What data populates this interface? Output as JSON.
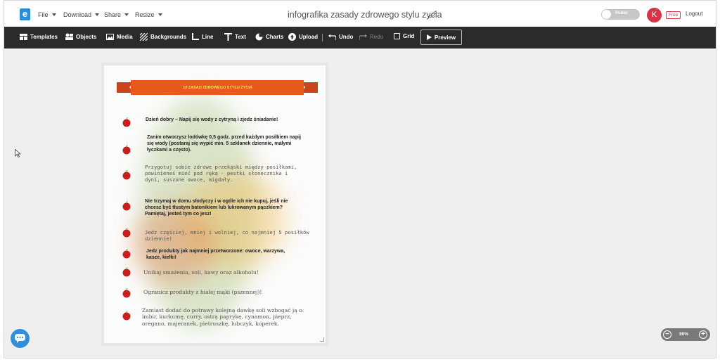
{
  "app": {
    "logo_letter": "e"
  },
  "menu": {
    "file": "File",
    "download": "Download",
    "share": "Share",
    "resize": "Resize"
  },
  "document": {
    "title": "infografika zasady zdrowego stylu zycia"
  },
  "visibility": {
    "label": "Public"
  },
  "account": {
    "avatar_letter": "K",
    "plan": "Free",
    "logout": "Logout"
  },
  "toolbar": {
    "templates": "Templates",
    "objects": "Objects",
    "media": "Media",
    "backgrounds": "Backgrounds",
    "line": "Line",
    "text": "Text",
    "charts": "Charts",
    "upload": "Upload",
    "undo": "Undo",
    "redo": "Redo",
    "grid": "Grid",
    "preview": "Preview"
  },
  "infographic": {
    "banner_title": "10 ZASAD ZDROWEGO STYLU ŻYCIA",
    "rules": [
      "Dzień dobry – Napij się wody z cytryną i zjedz śniadanie!",
      "Zanim otworzysz lodówkę 0,5 godz. przed każdym posiłkiem napij się wody (postaraj się wypić min. 5 szklanek dziennie, małymi łyczkami a często).",
      "Przygotuj sobie zdrowe przekąski między posiłkami, powinieneś mieć pod ręką - pestki słonecznika i dyni, suszone owoce, migdały.",
      "Nie trzymaj w domu słodyczy i w ogóle ich nie kupuj, jeśli nie chcesz być tłustym batonikiem lub lukrowanym pączkiem? Pamiętaj, jesteś tym co jesz!",
      "Jedz częściej, mniej i wolniej, co najmniej 5 posiłków dziennie!",
      "Jedz produkty jak najmniej przetworzone: owoce, warzywa, kasze, kiełki!",
      "Unikaj smażenia, soli, kawy oraz alkoholu!",
      "Ogranicz produkty z białej mąki (pszennej)!",
      "Zamiast dodać do potrawy kolejną dawkę soli wzbogać ją o: imbir, kurkumę, curry, ostrą paprykę, cynamon, pieprz, oregano, majeranek, pietruszkę, lubczyk, koperek."
    ]
  },
  "zoom": {
    "level": "90%"
  },
  "colors": {
    "accent": "#2a8fd6",
    "toolbar": "#2b2b2b",
    "banner": "#e85a1c",
    "avatar": "#d9334a"
  },
  "icons": [
    "logo-icon",
    "pencil-icon",
    "apple-icon",
    "chat-icon",
    "zoom-out-icon",
    "zoom-in-icon",
    "cursor-icon"
  ]
}
